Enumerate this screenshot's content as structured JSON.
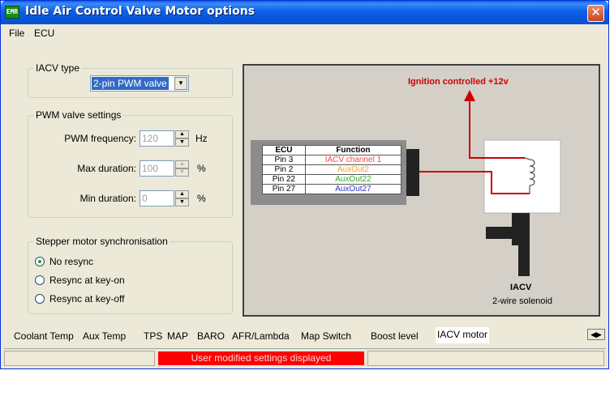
{
  "window": {
    "title": "Idle Air Control Valve Motor options",
    "icon_text": "EMR",
    "close_glyph": "✕"
  },
  "menu": {
    "items": [
      "File",
      "ECU"
    ]
  },
  "iacv_type": {
    "title": "IACV type",
    "selected": "2-pin PWM valve"
  },
  "pwm": {
    "title": "PWM valve settings",
    "frequency": {
      "label": "PWM frequency:",
      "value": "120",
      "unit": "Hz"
    },
    "max_duration": {
      "label": "Max duration:",
      "value": "100",
      "unit": "%"
    },
    "min_duration": {
      "label": "Min duration:",
      "value": "0",
      "unit": "%"
    }
  },
  "stepper": {
    "title": "Stepper motor synchronisation",
    "options": [
      {
        "label": "No resync",
        "checked": true
      },
      {
        "label": "Resync at key-on",
        "checked": false
      },
      {
        "label": "Resync at key-off",
        "checked": false
      }
    ]
  },
  "diagram": {
    "ignition_label": "Ignition controlled +12v",
    "device_title": "IACV",
    "device_subtitle": "2-wire solenoid",
    "table": {
      "headers": [
        "ECU",
        "Function"
      ],
      "rows": [
        {
          "pin": "Pin 3",
          "function": "IACV channel 1",
          "color": "#ff4040"
        },
        {
          "pin": "Pin 2",
          "function": "AuxOut2",
          "color": "#ff9933"
        },
        {
          "pin": "Pin 22",
          "function": "AuxOut22",
          "color": "#33aa33"
        },
        {
          "pin": "Pin 27",
          "function": "AuxOut27",
          "color": "#3333cc"
        }
      ]
    },
    "colors": {
      "wire": "#cc0000",
      "background": "#d4d0c8"
    }
  },
  "tabs": {
    "items": [
      "Coolant Temp",
      "Aux Temp",
      "TPS",
      "MAP",
      "BARO",
      "AFR/Lambda",
      "Map Switch",
      "Boost level",
      "IACV motor"
    ],
    "active": "IACV motor"
  },
  "status": {
    "message": "User modified settings displayed",
    "alert_color": "#ff0000"
  }
}
